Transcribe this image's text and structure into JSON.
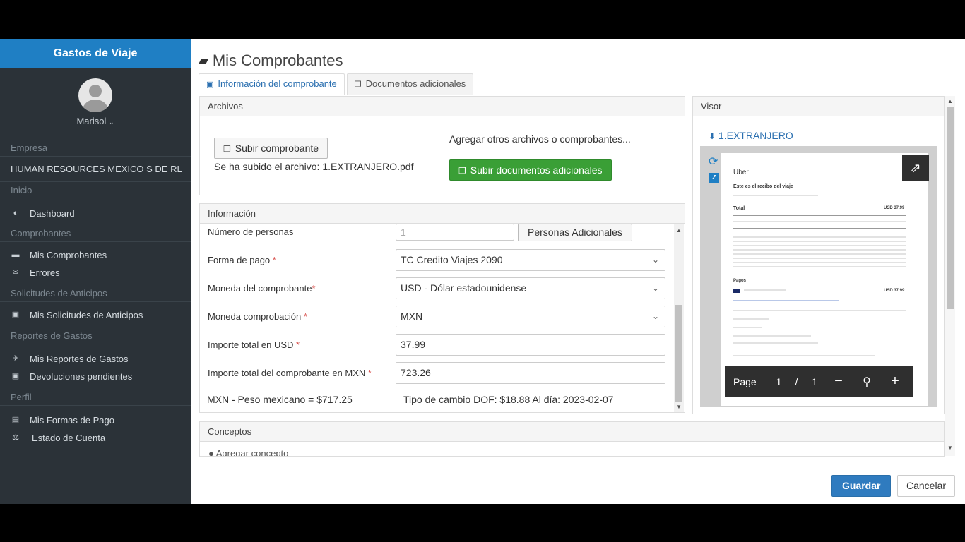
{
  "sidebar": {
    "brand": "Gastos de Viaje",
    "user": "Marisol",
    "sections": {
      "empresa": "Empresa",
      "company_name": "HUMAN RESOURCES MEXICO S DE RL",
      "inicio": "Inicio",
      "dashboard": "Dashboard",
      "comprobantes": "Comprobantes",
      "mis_comprobantes": "Mis Comprobantes",
      "errores": "Errores",
      "solicitudes": "Solicitudes de Anticipos",
      "mis_solicitudes": "Mis Solicitudes de Anticipos",
      "reportes": "Reportes de Gastos",
      "mis_reportes": "Mis Reportes de Gastos",
      "devoluciones": "Devoluciones pendientes",
      "perfil": "Perfil",
      "formas_pago": "Mis Formas de Pago",
      "estado_cuenta": "Estado de Cuenta"
    }
  },
  "page": {
    "title": "Mis Comprobantes",
    "tabs": [
      {
        "label": "Información del comprobante"
      },
      {
        "label": "Documentos adicionales"
      }
    ]
  },
  "archivos": {
    "header": "Archivos",
    "upload_button": "Subir comprobante",
    "uploaded_text": "Se ha subido el archivo: 1.EXTRANJERO.pdf",
    "other_text": "Agregar otros archivos o comprobantes...",
    "additional_button": "Subir documentos adicionales"
  },
  "informacion": {
    "header": "Información",
    "personas_label": "Número de personas",
    "personas_value": "1",
    "personas_button": "Personas Adicionales",
    "forma_pago_label": "Forma de pago",
    "forma_pago_value": "TC Credito Viajes 2090",
    "moneda_comp_label": "Moneda del comprobante",
    "moneda_comp_value": "USD - Dólar estadounidense",
    "moneda_comprob_label": "Moneda comprobación",
    "moneda_comprob_value": "MXN",
    "importe_usd_label": "Importe total en USD",
    "importe_usd_value": "37.99",
    "importe_mxn_label": "Importe total del comprobante en MXN",
    "importe_mxn_value": "723.26",
    "conversion_text": "MXN - Peso mexicano = $717.25",
    "tipo_cambio_text": "Tipo de cambio DOF: $18.88 Al día: 2023-02-07",
    "required_mark": "*"
  },
  "conceptos": {
    "header": "Conceptos",
    "add_label": "Agregar concepto"
  },
  "visor": {
    "header": "Visor",
    "file_link": "1.EXTRANJERO",
    "doc_brand": "Uber",
    "doc_heading": "Este es el recibo del viaje",
    "doc_total_label": "Total",
    "doc_total_value": "USD 37.99",
    "doc_pagos": "Pagos",
    "doc_pago_value": "USD 37.99",
    "pager_page": "Page",
    "pager_current": "1",
    "pager_sep": "/",
    "pager_total": "1"
  },
  "footer": {
    "save": "Guardar",
    "cancel": "Cancelar"
  },
  "colors": {
    "brand": "#1f7fc4",
    "sidebar": "#2b3238",
    "success": "#3a9f36",
    "primary": "#2f7bbf"
  }
}
